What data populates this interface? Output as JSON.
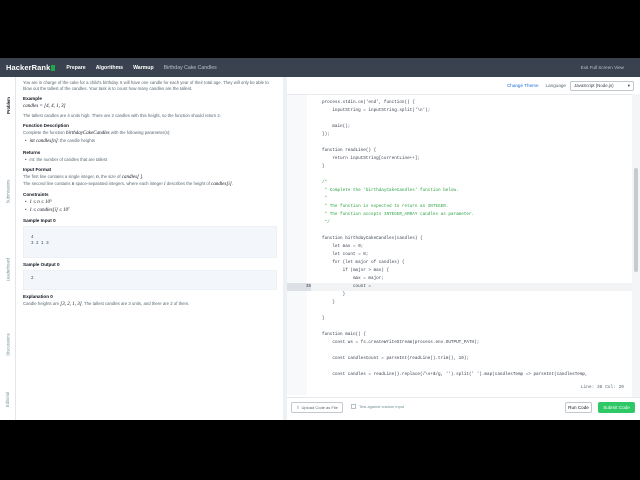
{
  "nav": {
    "logo": "HackerRank",
    "items": [
      {
        "label": "Prepare"
      },
      {
        "label": "Algorithms"
      },
      {
        "label": "Warmup"
      }
    ],
    "crumb": "Birthday Cake Candles",
    "exit": "Exit Full Screen View"
  },
  "rail": {
    "tabs": [
      {
        "label": "Problem",
        "active": true
      },
      {
        "label": "Submissions",
        "active": false
      },
      {
        "label": "Leaderboard",
        "active": false
      },
      {
        "label": "Discussions",
        "active": false
      },
      {
        "label": "Editorial",
        "active": false
      }
    ]
  },
  "problem": {
    "intro": "You are in charge of the cake for a child's birthday. It will have one candle for each year of their total age. They will only be able to blow out the tallest of the candles. Your task is to count how many candles are the tallest.",
    "example_heading": "Example",
    "example_math": "candles = [4, 4, 1, 3]",
    "example_text": "The tallest candles are 4 units high. There are 2 candles with this height, so the function should return 2.",
    "fd_heading": "Function Description",
    "fd_text_pre": "Complete the function",
    "fd_func": "birthdayCakeCandles",
    "fd_text_post": "with the following parameter(s):",
    "fd_param_code": "int",
    "fd_param_math": "candles[n]",
    "fd_param_text": ": the candle heights",
    "returns_heading": "Returns",
    "returns_item": "int: the number of candles that are tallest",
    "input_heading": "Input Format",
    "input_line1_pre": "The first line contains a single integer,",
    "input_line1_n": "n",
    "input_line1_post": ", the size of",
    "input_line1_c": "candles[ ]",
    "input_line2_pre": "The second line contains",
    "input_line2_n": "n",
    "input_line2_mid": "space-separated integers, where each integer",
    "input_line2_i": "i",
    "input_line2_post": "describes the height of",
    "input_line2_c": "candles[i]",
    "constraints_heading": "Constraints",
    "constraint1": "1 ≤ n ≤ 10⁵",
    "constraint2": "1 ≤ candles[i] ≤ 10⁷",
    "sample_input_heading": "Sample Input 0",
    "sample_input": "4\n3 2 1 3",
    "sample_output_heading": "Sample Output 0",
    "sample_output": "2",
    "explanation_heading": "Explanation 0",
    "explanation_pre": "Candle heights are",
    "explanation_math": "[3, 2, 1, 3]",
    "explanation_post": ". The tallest candles are 3 units, and there are 2 of them."
  },
  "editor": {
    "change_theme": "Change Theme",
    "language_label": "Language",
    "language_value": "JavaScript (Node.js)",
    "lines": [
      {
        "n": "",
        "text": "process.stdin.on('end', function() {",
        "kind": "code"
      },
      {
        "n": "",
        "text": "    inputString = inputString.split('\\n');",
        "kind": "code"
      },
      {
        "n": "",
        "text": "",
        "kind": "code"
      },
      {
        "n": "",
        "text": "    main();",
        "kind": "code"
      },
      {
        "n": "",
        "text": "});",
        "kind": "code"
      },
      {
        "n": "",
        "text": "",
        "kind": "code"
      },
      {
        "n": "",
        "text": "function readLine() {",
        "kind": "code"
      },
      {
        "n": "",
        "text": "    return inputString[currentLine++];",
        "kind": "code"
      },
      {
        "n": "",
        "text": "}",
        "kind": "code"
      },
      {
        "n": "",
        "text": "",
        "kind": "code"
      },
      {
        "n": "",
        "text": "/*",
        "kind": "cmt"
      },
      {
        "n": "",
        "text": " * Complete the 'birthdayCakeCandles' function below.",
        "kind": "cmt"
      },
      {
        "n": "",
        "text": " *",
        "kind": "cmt"
      },
      {
        "n": "",
        "text": " * The function is expected to return an INTEGER.",
        "kind": "cmt"
      },
      {
        "n": "",
        "text": " * The function accepts INTEGER_ARRAY candles as parameter.",
        "kind": "cmt"
      },
      {
        "n": "",
        "text": " */",
        "kind": "cmt"
      },
      {
        "n": "",
        "text": "",
        "kind": "code"
      },
      {
        "n": "",
        "text": "function birthdayCakeCandles(candles) {",
        "kind": "code"
      },
      {
        "n": "",
        "text": "    let max = 0;",
        "kind": "code"
      },
      {
        "n": "",
        "text": "    let count = 0;",
        "kind": "code"
      },
      {
        "n": "",
        "text": "    for (let major of candles) {",
        "kind": "code"
      },
      {
        "n": "",
        "text": "        if (major > max) {",
        "kind": "code"
      },
      {
        "n": "",
        "text": "            max = major;",
        "kind": "code"
      },
      {
        "n": "38",
        "text": "            count =",
        "kind": "active"
      },
      {
        "n": "",
        "text": "        }",
        "kind": "code"
      },
      {
        "n": "",
        "text": "    }",
        "kind": "code"
      },
      {
        "n": "",
        "text": "",
        "kind": "code"
      },
      {
        "n": "",
        "text": "}",
        "kind": "code"
      },
      {
        "n": "",
        "text": "",
        "kind": "code"
      },
      {
        "n": "",
        "text": "function main() {",
        "kind": "code"
      },
      {
        "n": "",
        "text": "    const ws = fs.createWriteStream(process.env.OUTPUT_PATH);",
        "kind": "code"
      },
      {
        "n": "",
        "text": "",
        "kind": "code"
      },
      {
        "n": "",
        "text": "    const candlesCount = parseInt(readLine().trim(), 10);",
        "kind": "code"
      },
      {
        "n": "",
        "text": "",
        "kind": "code"
      },
      {
        "n": "",
        "text": "    const candles = readLine().replace(/\\s+$/g, '').split(' ').map(candlesTemp => parseInt(candlesTemp,",
        "kind": "code"
      }
    ],
    "status": "Line: 38 Col: 20"
  },
  "bottom": {
    "upload": "Upload Code as File",
    "custom_input": "Test against custom input",
    "run": "Run Code",
    "submit": "Submit Code"
  }
}
